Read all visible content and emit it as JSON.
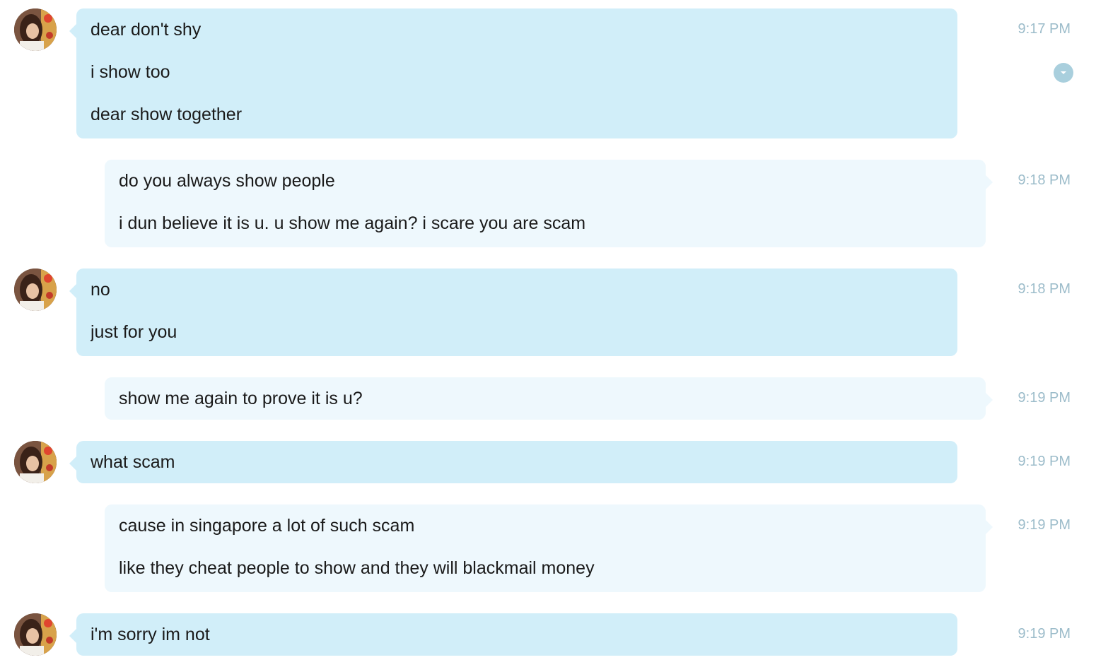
{
  "colors": {
    "incoming_bubble": "#d1eef9",
    "outgoing_bubble": "#eef8fd",
    "timestamp": "#9cbcca",
    "menu_button": "#a9cfdd"
  },
  "icons": {
    "avatar": "avatar-photo",
    "message_menu": "chevron-down-icon"
  },
  "messages": [
    {
      "direction": "incoming",
      "time": "9:17 PM",
      "lines": [
        "dear don't shy",
        "i show too",
        "dear show together"
      ]
    },
    {
      "direction": "outgoing",
      "time": "9:18 PM",
      "lines": [
        "do you always show people",
        "i dun believe it is u. u show me again? i scare you are scam"
      ]
    },
    {
      "direction": "incoming",
      "time": "9:18 PM",
      "lines": [
        "no",
        "just for you"
      ]
    },
    {
      "direction": "outgoing",
      "time": "9:19 PM",
      "lines": [
        "show me again to prove it is u?"
      ]
    },
    {
      "direction": "incoming",
      "time": "9:19 PM",
      "lines": [
        "what scam"
      ]
    },
    {
      "direction": "outgoing",
      "time": "9:19 PM",
      "lines": [
        "cause in singapore a lot of such scam",
        "like they cheat people to show and they will blackmail money"
      ]
    },
    {
      "direction": "incoming",
      "time": "9:19 PM",
      "lines": [
        "i'm sorry im not"
      ]
    }
  ]
}
